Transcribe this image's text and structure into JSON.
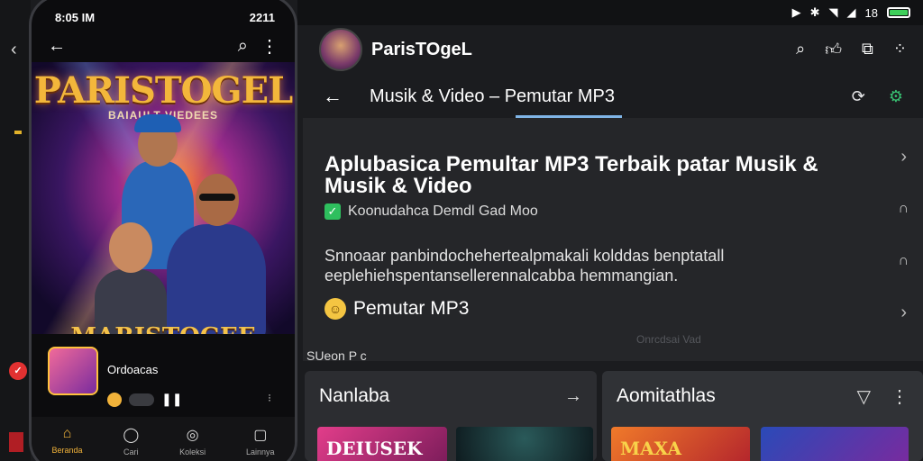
{
  "system_status": {
    "time": "18"
  },
  "phone": {
    "status_time": "8:05 IM",
    "status_right": "2211",
    "hero_title": "PARISTOGEL",
    "hero_subtitle": "BAIAULT VIEDEES",
    "hero_caption": "MARISTOGEE",
    "mini_player_title": "Ordoacas",
    "tabs": [
      {
        "label": "Beranda",
        "icon": "home-icon"
      },
      {
        "label": "Cari",
        "icon": "search-icon"
      },
      {
        "label": "Koleksi",
        "icon": "library-icon"
      },
      {
        "label": "Lainnya",
        "icon": "more-icon"
      }
    ]
  },
  "header": {
    "app_title": "ParisTOgeL"
  },
  "subheader": {
    "title": "Musik & Video – Pemutar MP3"
  },
  "content": {
    "headline": "Aplubasica Pemultar MP3 Terbaik patar Musik & Musik & Video",
    "check_label": "Koonudahca Demdl Gad Moo",
    "description": "Snnoaar panbindochehertealpmakali kolddas benptatall eeplehiehspentansellerennalcabba hemmangian.",
    "player_label": "Pemutar MP3",
    "faint_text": "Onrcdsai Vad"
  },
  "section_label": "SUeon P c",
  "cards": {
    "left": {
      "title": "Nanlaba",
      "thumb1_text": "DEIUSEK"
    },
    "right": {
      "title": "Aomitathlas",
      "thumb1_text": "MAXA"
    }
  }
}
